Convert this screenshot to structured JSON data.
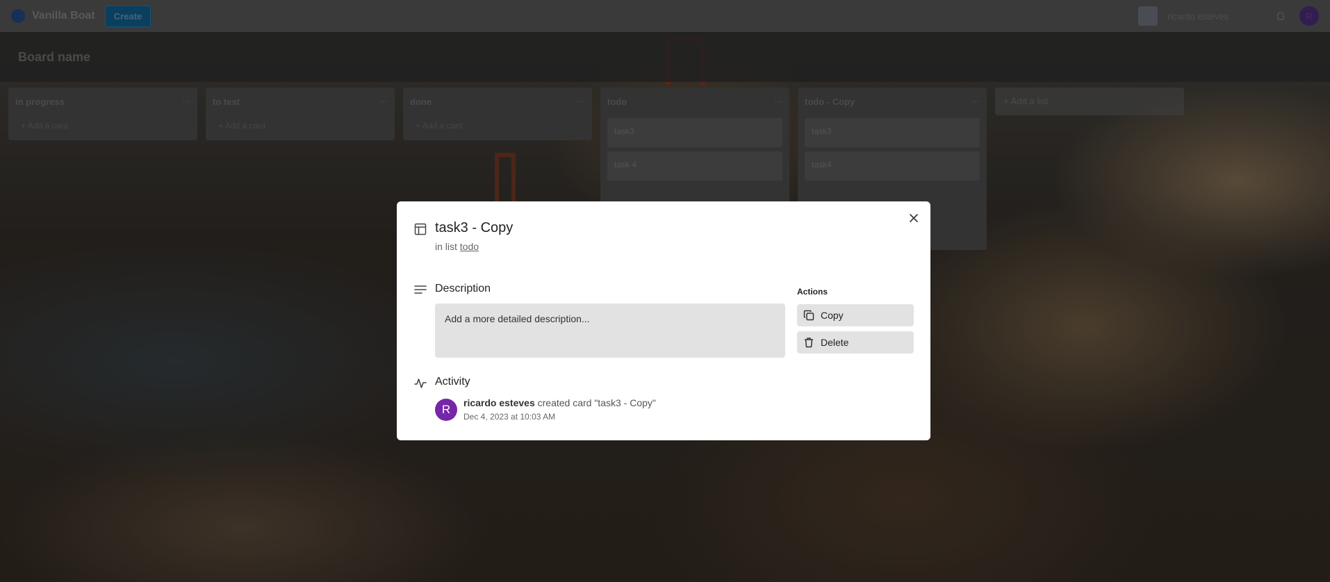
{
  "topbar": {
    "app_name": "Vanilla Boat",
    "create_label": "Create",
    "user_name": "ricardo esteves",
    "avatar_initial": "R"
  },
  "board": {
    "title": "Board name"
  },
  "lists": [
    {
      "title": "in progress",
      "add_card_label": "Add a card",
      "cards": []
    },
    {
      "title": "to test",
      "add_card_label": "Add a card",
      "cards": []
    },
    {
      "title": "done",
      "add_card_label": "Add a card",
      "cards": []
    },
    {
      "title": "todo",
      "add_card_label": "",
      "cards": [
        "task3",
        "task 4"
      ]
    },
    {
      "title": "todo - Copy",
      "add_card_label": "",
      "cards": [
        "task3",
        "task4"
      ]
    }
  ],
  "add_list_label": "Add a list",
  "modal": {
    "title": "task3 - Copy",
    "in_list_prefix": "in list",
    "list_name": "todo",
    "description_heading": "Description",
    "description_placeholder": "Add a more detailed description...",
    "actions_heading": "Actions",
    "copy_label": "Copy",
    "delete_label": "Delete",
    "activity_heading": "Activity",
    "activity": {
      "avatar_initial": "R",
      "user": "ricardo esteves",
      "text": " created card \"task3 - Copy\"",
      "time": "Dec 4, 2023 at 10:03 AM",
      "avatar_color": "#7626a8"
    }
  }
}
